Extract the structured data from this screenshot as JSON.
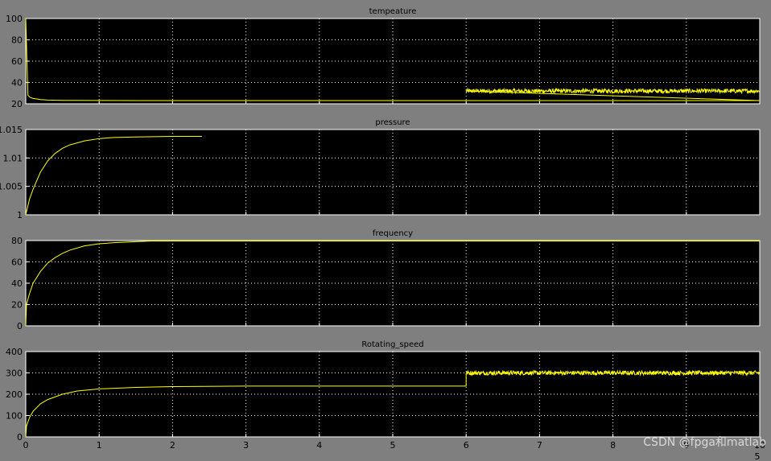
{
  "colors": {
    "figure_background": "#7f7f7f",
    "axes_background": "#000000",
    "grid": "#ffffff",
    "signal": "#ffff00",
    "frame": "#ffffff",
    "text": "#000000"
  },
  "watermark": "CSDN @fpga和matlab",
  "x_exponent_label": "5",
  "chart_data": [
    {
      "type": "line",
      "title": "tempeature",
      "xlim": [
        0,
        10
      ],
      "ylim": [
        20,
        100
      ],
      "yticks": [
        20,
        40,
        60,
        80,
        100
      ],
      "xticks": [],
      "grid": true,
      "series": [
        {
          "color": "#ffff00",
          "x": [
            0,
            0.03,
            0.06,
            0.1,
            0.15,
            0.2,
            0.3,
            0.5,
            1.5,
            6.0,
            10
          ],
          "y": [
            100,
            28,
            26,
            25,
            24.5,
            24,
            23.5,
            23.2,
            23,
            23,
            23
          ],
          "noise_segment": {
            "x_start": 6.0,
            "x_end": 10,
            "mean": 32,
            "amplitude": 2
          }
        }
      ]
    },
    {
      "type": "line",
      "title": "pressure",
      "xlim": [
        0,
        10
      ],
      "ylim": [
        1,
        1.015
      ],
      "yticks": [
        1,
        1.005,
        1.01,
        1.015
      ],
      "xticks": [],
      "grid": true,
      "series": [
        {
          "color": "#ffff00",
          "x": [
            0,
            0.05,
            0.1,
            0.2,
            0.3,
            0.4,
            0.5,
            0.6,
            0.8,
            1.0,
            1.2,
            1.5,
            2.0,
            2.4
          ],
          "y": [
            1.0,
            1.0027,
            1.0045,
            1.0075,
            1.0095,
            1.0108,
            1.0117,
            1.0123,
            1.013,
            1.0134,
            1.0136,
            1.0137,
            1.0138,
            1.0138
          ]
        }
      ]
    },
    {
      "type": "line",
      "title": "frequency",
      "xlim": [
        0,
        10
      ],
      "ylim": [
        0,
        80
      ],
      "yticks": [
        0,
        20,
        40,
        60,
        80
      ],
      "xticks": [],
      "grid": true,
      "series": [
        {
          "color": "#ffff00",
          "x": [
            0,
            0.01,
            0.05,
            0.1,
            0.2,
            0.3,
            0.4,
            0.5,
            0.6,
            0.8,
            1.0,
            1.2,
            1.5,
            1.7,
            10
          ],
          "y": [
            0,
            20,
            30,
            40,
            51,
            59,
            64,
            68,
            71,
            75,
            77,
            78,
            79,
            79.5,
            79.5
          ]
        }
      ]
    },
    {
      "type": "line",
      "title": "Rotating_speed",
      "xlim": [
        0,
        10
      ],
      "ylim": [
        0,
        400
      ],
      "yticks": [
        0,
        100,
        200,
        300,
        400
      ],
      "xticks": [
        0,
        1,
        2,
        3,
        4,
        5,
        6,
        7,
        8,
        9,
        10
      ],
      "xtick_labels": [
        "0",
        "1",
        "2",
        "3",
        "4",
        "5",
        "6",
        "7",
        "8",
        "9",
        "10"
      ],
      "grid": true,
      "series": [
        {
          "color": "#ffff00",
          "x": [
            0,
            0.01,
            0.05,
            0.1,
            0.2,
            0.3,
            0.5,
            0.7,
            1.0,
            1.5,
            2.0,
            3.0,
            6.0
          ],
          "y": [
            0,
            50,
            90,
            120,
            155,
            175,
            200,
            215,
            225,
            232,
            236,
            238,
            238
          ],
          "noise_segment": {
            "x_start": 6.0,
            "x_end": 10,
            "mean": 300,
            "amplitude": 10
          }
        }
      ]
    }
  ]
}
